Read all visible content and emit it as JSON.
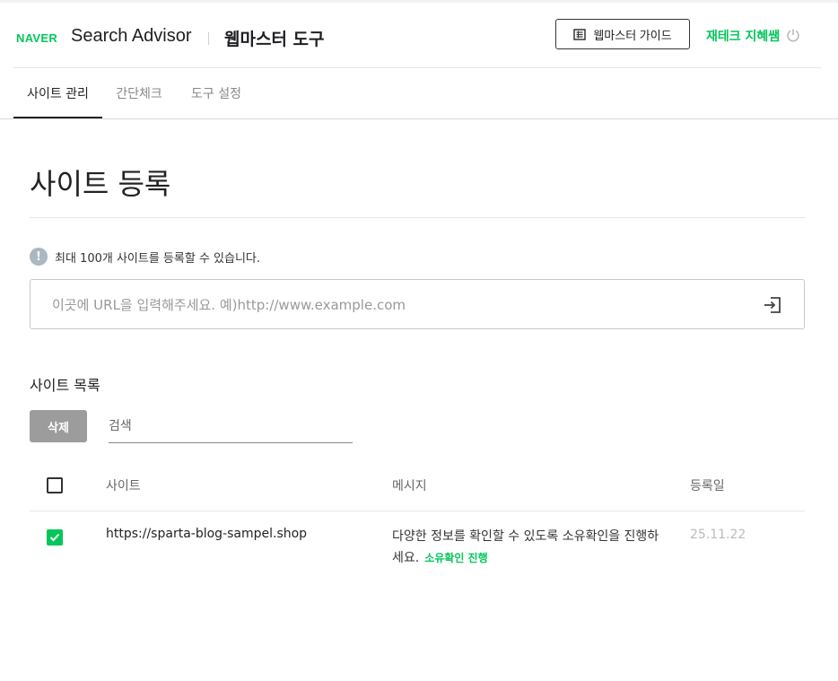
{
  "header": {
    "brand": "NAVER",
    "product": "Search Advisor",
    "section": "웹마스터 도구",
    "guide_label": "웹마스터 가이드",
    "user_name": "재테크 지혜쌤"
  },
  "tabs": [
    {
      "label": "사이트 관리",
      "active": true
    },
    {
      "label": "간단체크",
      "active": false
    },
    {
      "label": "도구 설정",
      "active": false
    }
  ],
  "page": {
    "title": "사이트 등록",
    "notice": "최대 100개 사이트를 등록할 수 있습니다.",
    "url_placeholder": "이곳에 URL을 입력해주세요. 예)http://www.example.com"
  },
  "site_list": {
    "title": "사이트 목록",
    "delete_label": "삭제",
    "search_placeholder": "검색",
    "columns": {
      "site": "사이트",
      "message": "메시지",
      "date": "등록일"
    },
    "rows": [
      {
        "checked": true,
        "site": "https://sparta-blog-sampel.shop",
        "message": "다양한 정보를 확인할 수 있도록 소유확인을 진행하세요.",
        "message_link": "소유확인 진행",
        "date": "25.11.22"
      }
    ]
  },
  "colors": {
    "accent": "#03c75a",
    "text": "#222222",
    "muted": "#888888",
    "disabled_button": "#9c9c9c"
  },
  "icons": {
    "guide": "document-list-icon",
    "logout": "power-icon",
    "info": "info-icon",
    "submit": "enter-icon",
    "check": "checkmark-icon"
  }
}
